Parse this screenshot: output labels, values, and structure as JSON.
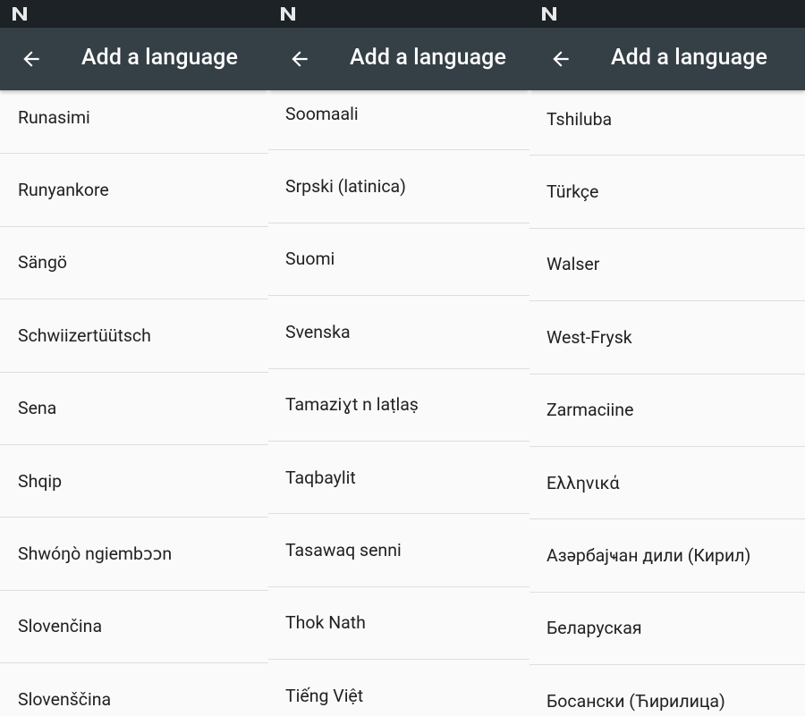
{
  "panels": [
    {
      "title": "Add a language",
      "languages": [
        "Runasimi",
        "Runyankore",
        "Sängö",
        "Schwiizertüütsch",
        "Sena",
        "Shqip",
        "Shwóŋò ngiembɔɔn",
        "Slovenčina",
        "Slovenščina"
      ]
    },
    {
      "title": "Add a language",
      "languages": [
        "Soomaali",
        "Srpski (latinica)",
        "Suomi",
        "Svenska",
        "Tamaziɣt n laṭlaṣ",
        "Taqbaylit",
        "Tasawaq senni",
        "Thok Nath",
        "Tiếng Việt"
      ]
    },
    {
      "title": "Add a language",
      "languages": [
        "Tshiluba",
        "Türkçe",
        "Walser",
        "West-Frysk",
        "Zarmaciine",
        "Ελληνικά",
        "Азәрбајҹан дили (Кирил)",
        "Беларуская",
        "Босански (Ћирилица)"
      ]
    }
  ],
  "colors": {
    "status_bar": "#1c2226",
    "app_bar": "#353f46",
    "background": "#fafafa",
    "divider": "#dedede",
    "text": "#212121"
  },
  "icons": {
    "status": "android-n-notification-icon",
    "back": "arrow-back-icon"
  }
}
